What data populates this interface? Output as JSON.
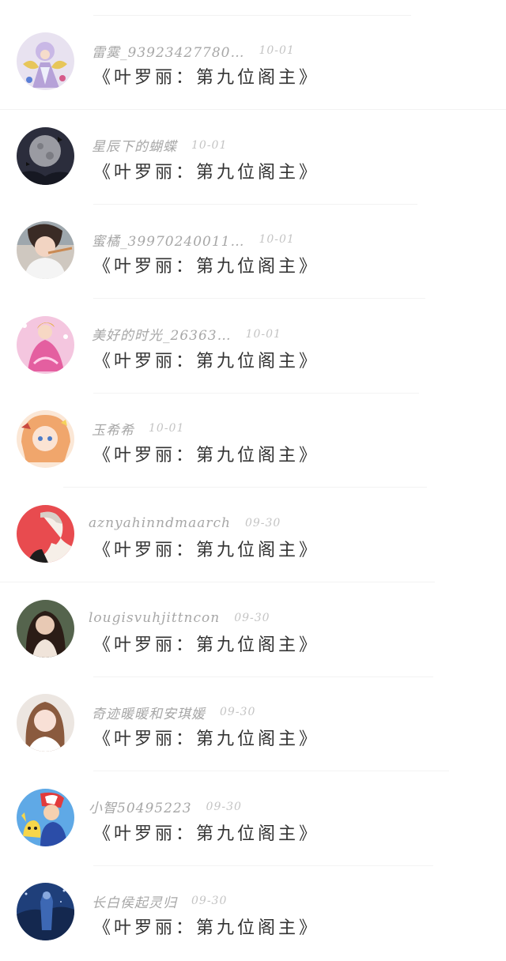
{
  "comments": [
    {
      "username": "雷霙_93923427780…",
      "date": "10-01",
      "text": "《叶罗丽：第九位阁主》",
      "avatar": "anime-fairy-avatar"
    },
    {
      "username": "星辰下的蝴蝶",
      "date": "10-01",
      "text": "《叶罗丽：第九位阁主》",
      "avatar": "moon-night-avatar"
    },
    {
      "username": "蜜橘_39970240011…",
      "date": "10-01",
      "text": "《叶罗丽：第九位阁主》",
      "avatar": "girl-photo-avatar"
    },
    {
      "username": "美好的时光_26363…",
      "date": "10-01",
      "text": "《叶罗丽：第九位阁主》",
      "avatar": "pink-doll-avatar"
    },
    {
      "username": "玉希希",
      "date": "10-01",
      "text": "《叶罗丽：第九位阁主》",
      "avatar": "anime-girl-avatar"
    },
    {
      "username": "aznyahinndmaarch",
      "date": "09-30",
      "text": "《叶罗丽：第九位阁主》",
      "avatar": "sketch-boy-avatar"
    },
    {
      "username": "lougisvuhjittncon",
      "date": "09-30",
      "text": "《叶罗丽：第九位阁主》",
      "avatar": "woman-portrait-avatar"
    },
    {
      "username": "奇迹暖暖和安琪媛",
      "date": "09-30",
      "text": "《叶罗丽：第九位阁主》",
      "avatar": "woman-selfie-avatar"
    },
    {
      "username": "小智50495223",
      "date": "09-30",
      "text": "《叶罗丽：第九位阁主》",
      "avatar": "pokemon-trainer-avatar"
    },
    {
      "username": "长白侯起灵归",
      "date": "09-30",
      "text": "《叶罗丽：第九位阁主》",
      "avatar": "blue-scene-avatar"
    }
  ]
}
